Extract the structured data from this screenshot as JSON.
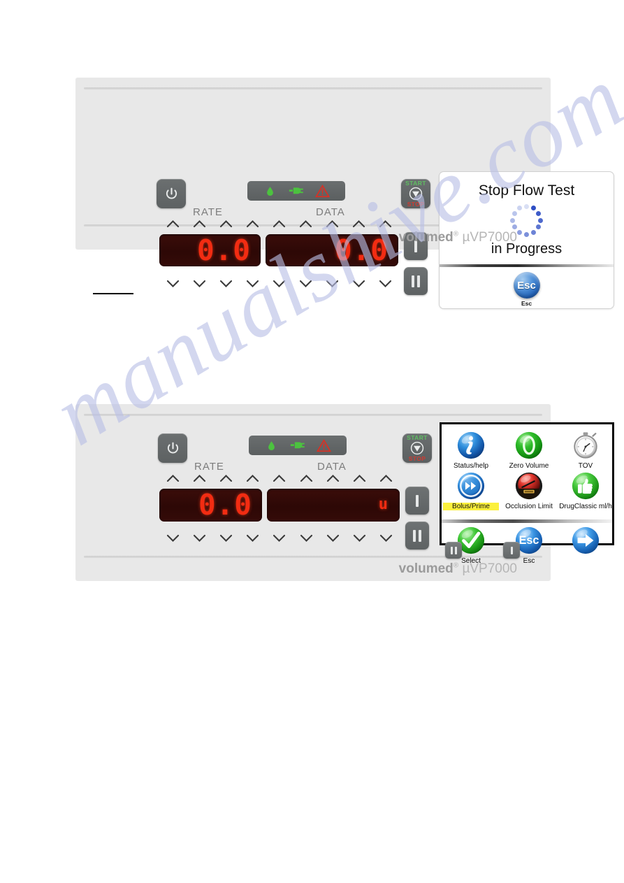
{
  "page": {
    "watermark_text": "manualshive.com",
    "accent_colors": {
      "segment_red": "#f22c12",
      "display_bg": "#2d0806",
      "panel_bg": "#e8e8e8",
      "led_bar": "#62666700",
      "highlight_yellow": "#fbf03c",
      "spinner_blue": "#2f4fc4",
      "start_green": "#5fbf62",
      "stop_red": "#cf3b31"
    }
  },
  "panel1": {
    "brand_name": "volumed",
    "brand_reg": "®",
    "brand_model": "µVP7000",
    "power_icon": "power-icon",
    "leds": [
      {
        "name": "drop-icon",
        "label": "drop"
      },
      {
        "name": "mains-plug-icon",
        "label": "mains"
      },
      {
        "name": "alarm-triangle-icon",
        "label": "alarm"
      }
    ],
    "labels": {
      "rate": "RATE",
      "data": "DATA"
    },
    "display_rate": "0.0",
    "display_data": "0.0",
    "start_label": "START",
    "stop_label": "STOP",
    "key_select": "I",
    "key_pause": "II",
    "screen": {
      "title": "Stop Flow Test",
      "subtitle": "in Progress",
      "esc_button": "Esc",
      "esc_caption": "Esc",
      "spinner_name": "loading-spinner"
    }
  },
  "panel2": {
    "brand_name": "volumed",
    "brand_reg": "®",
    "brand_model": "µVP7000",
    "power_icon": "power-icon",
    "leds": [
      {
        "name": "drop-icon",
        "label": "drop"
      },
      {
        "name": "mains-plug-icon",
        "label": "mains"
      },
      {
        "name": "alarm-triangle-icon",
        "label": "alarm"
      }
    ],
    "labels": {
      "rate": "RATE",
      "data": "DATA"
    },
    "display_rate": "0.0",
    "display_data": "u",
    "start_label": "START",
    "stop_label": "STOP",
    "key_select": "I",
    "key_pause": "II",
    "menu": {
      "items": [
        {
          "label": "Status/help",
          "icon": "info-circle-icon",
          "highlighted": false
        },
        {
          "label": "Zero Volume",
          "icon": "zero-volume-icon",
          "highlighted": false
        },
        {
          "label": "TOV",
          "icon": "stopwatch-icon",
          "highlighted": false
        },
        {
          "label": "Bolus/Prime",
          "icon": "fast-forward-icon",
          "highlighted": true
        },
        {
          "label": "Occlusion Limit",
          "icon": "pressure-gauge-icon",
          "highlighted": false
        },
        {
          "label": "DrugClassic ml/h",
          "icon": "thumbs-up-icon",
          "highlighted": false
        }
      ],
      "softkeys": [
        {
          "label": "Select",
          "icon": "green-check-icon",
          "key": "II"
        },
        {
          "label": "Esc",
          "icon": "esc-circle-icon",
          "key": "I"
        },
        {
          "label": "",
          "icon": "arrow-right-icon",
          "key": ""
        }
      ]
    }
  }
}
